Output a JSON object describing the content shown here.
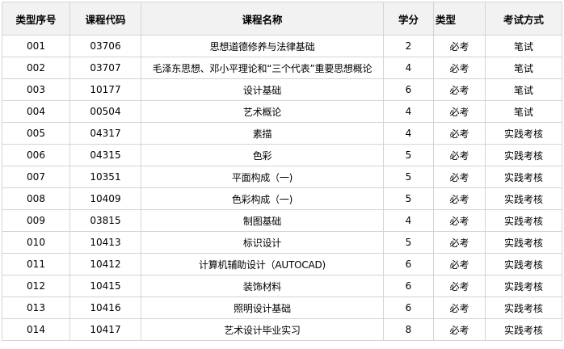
{
  "table": {
    "headers": [
      "类型序号",
      "课程代码",
      "课程名称",
      "学分",
      "类型",
      "考试方式"
    ],
    "rows": [
      [
        "001",
        "03706",
        "思想道德修养与法律基础",
        "2",
        "必考",
        "笔试"
      ],
      [
        "002",
        "03707",
        "毛泽东思想、邓小平理论和“三个代表”重要思想概论",
        "4",
        "必考",
        "笔试"
      ],
      [
        "003",
        "10177",
        "设计基础",
        "6",
        "必考",
        "笔试"
      ],
      [
        "004",
        "00504",
        "艺术概论",
        "4",
        "必考",
        "笔试"
      ],
      [
        "005",
        "04317",
        "素描",
        "4",
        "必考",
        "实践考核"
      ],
      [
        "006",
        "04315",
        "色彩",
        "5",
        "必考",
        "实践考核"
      ],
      [
        "007",
        "10351",
        "平面构成（一)",
        "5",
        "必考",
        "实践考核"
      ],
      [
        "008",
        "10409",
        "色彩构成（一)",
        "5",
        "必考",
        "实践考核"
      ],
      [
        "009",
        "03815",
        "制图基础",
        "4",
        "必考",
        "实践考核"
      ],
      [
        "010",
        "10413",
        "标识设计",
        "5",
        "必考",
        "实践考核"
      ],
      [
        "011",
        "10412",
        "计算机辅助设计（AUTOCAD)",
        "6",
        "必考",
        "实践考核"
      ],
      [
        "012",
        "10415",
        "装饰材料",
        "6",
        "必考",
        "实践考核"
      ],
      [
        "013",
        "10416",
        "照明设计基础",
        "6",
        "必考",
        "实践考核"
      ],
      [
        "014",
        "10417",
        "艺术设计毕业实习",
        "8",
        "必考",
        "实践考核"
      ]
    ]
  }
}
